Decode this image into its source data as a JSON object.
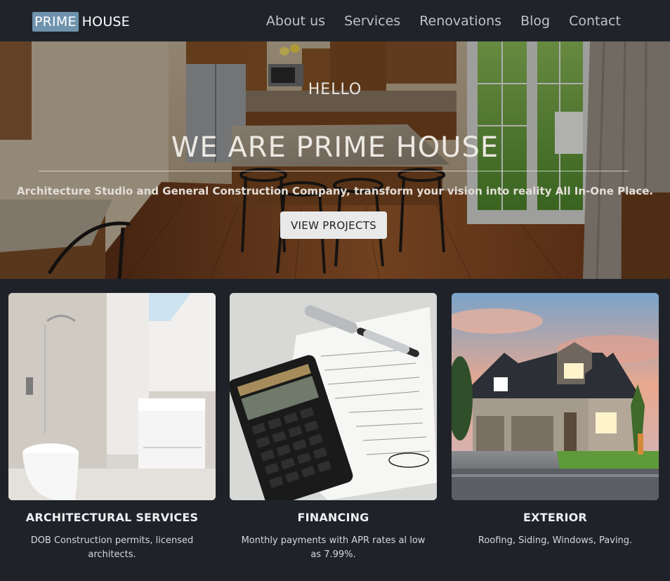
{
  "nav": {
    "logo_prime": "PRIME",
    "logo_house": "HOUSE",
    "links": [
      "About us",
      "Services",
      "Renovations",
      "Blog",
      "Contact"
    ]
  },
  "hero": {
    "hello": "HELLO",
    "title": "WE ARE PRIME HOUSE",
    "subtitle": "Architecture Studio and General Construction Company, transform your vision into reality All In-One Place.",
    "button": "VIEW PROJECTS"
  },
  "cards": [
    {
      "title": "ARCHITECTURAL SERVICES",
      "desc": "DOB Construction permits, licensed architects."
    },
    {
      "title": "FINANCING",
      "desc": "Monthly payments with APR rates al low as 7.99%."
    },
    {
      "title": "EXTERIOR",
      "desc": "Roofing, Siding, Windows, Paving."
    }
  ],
  "colors": {
    "background": "#1f2329",
    "logo_accent": "#6f93ad",
    "button_bg": "#e9e9ea"
  }
}
